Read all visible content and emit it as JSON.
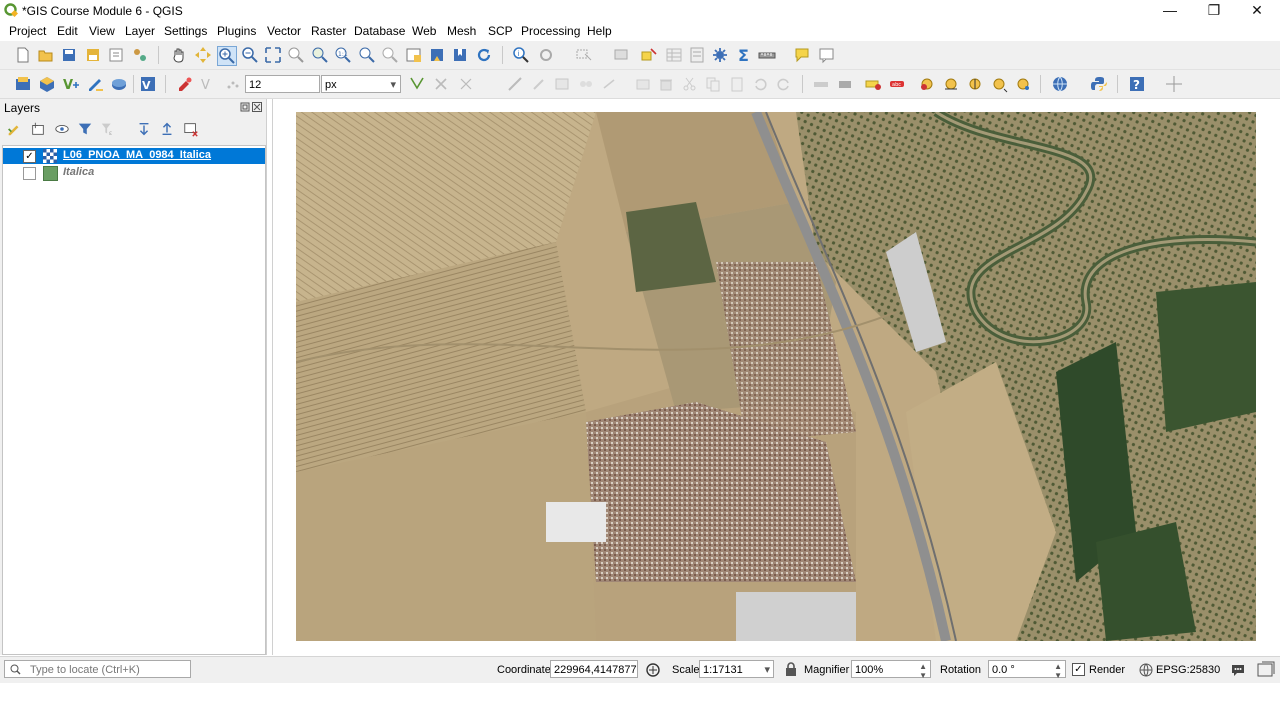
{
  "window": {
    "title": "*GIS Course Module 6 - QGIS",
    "minimize_glyph": "—",
    "restore_glyph": "❐",
    "close_glyph": "✕"
  },
  "menu": [
    "Project",
    "Edit",
    "View",
    "Layer",
    "Settings",
    "Plugins",
    "Vector",
    "Raster",
    "Database",
    "Web",
    "Mesh",
    "SCP",
    "Processing",
    "Help"
  ],
  "toolbar2": {
    "size_value": "12",
    "unit_value": "px"
  },
  "layers_panel": {
    "title": "Layers",
    "layers": [
      {
        "name": "L06_PNOA_MA_0984_Italica",
        "checked": true,
        "selected": true
      },
      {
        "name": "Italica",
        "checked": false,
        "selected": false
      }
    ],
    "check_glyph": "✓"
  },
  "status": {
    "locate_placeholder": "Type to locate (Ctrl+K)",
    "coordinate_label": "Coordinate",
    "coordinate_value": "229964,4147877",
    "scale_label": "Scale",
    "scale_value": "1:17131",
    "magnifier_label": "Magnifier",
    "magnifier_value": "100%",
    "rotation_label": "Rotation",
    "rotation_value": "0.0 °",
    "render_label": "Render",
    "render_checked": true,
    "crs_value": "EPSG:25830"
  },
  "colors": {
    "accent_blue": "#0078d7",
    "qgis_green": "#589632",
    "field_tan": "#c4b08a",
    "river_green": "#4a5e3a"
  }
}
